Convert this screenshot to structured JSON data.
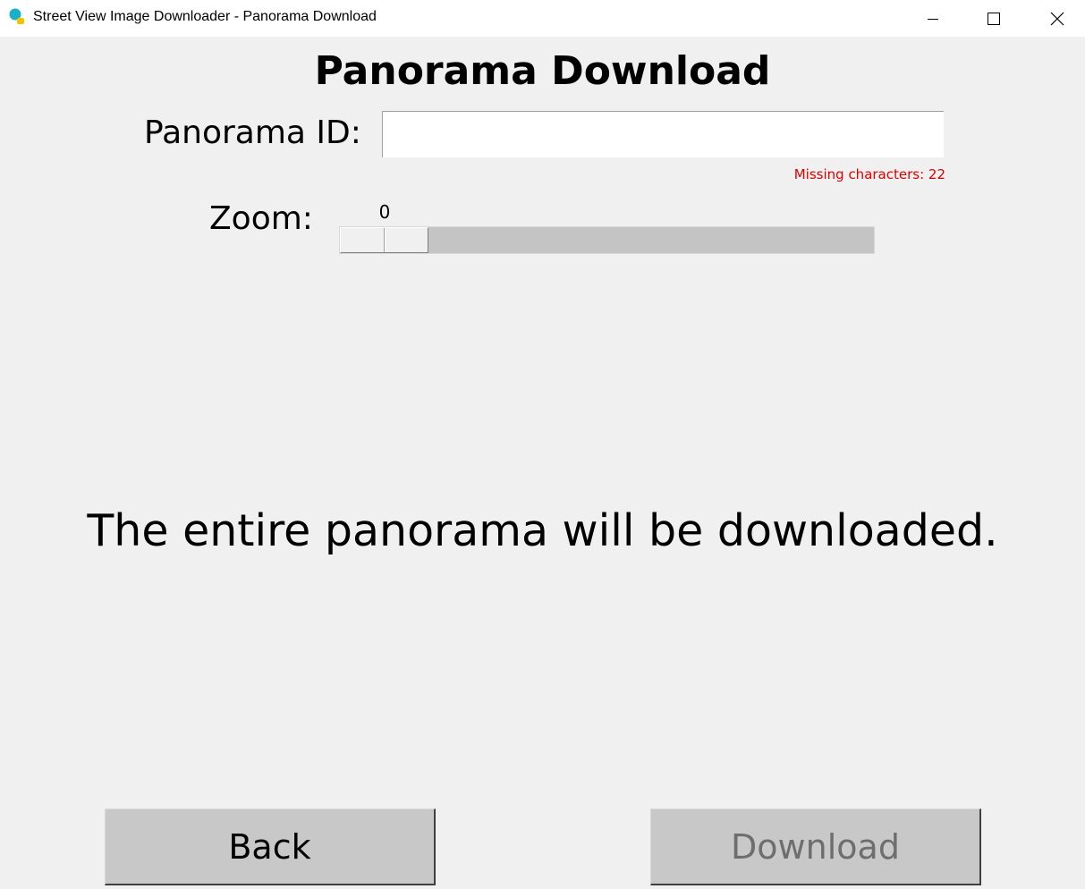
{
  "window": {
    "title": "Street View Image Downloader - Panorama Download"
  },
  "page": {
    "title": "Panorama Download",
    "id_label": "Panorama ID:",
    "id_value": "",
    "missing_chars": "Missing characters: 22",
    "zoom_label": "Zoom:",
    "zoom_value": "0",
    "info_text": "The entire panorama will be downloaded."
  },
  "buttons": {
    "back": "Back",
    "download": "Download"
  },
  "colors": {
    "background": "#f0f0f0",
    "error": "#e00000",
    "button": "#c8c8c8",
    "disabled_text": "#6e6e6e"
  },
  "icons": {
    "app": "street-view-app-icon",
    "minimize": "minimize-icon",
    "maximize": "maximize-icon",
    "close": "close-icon"
  },
  "zoom_slider": {
    "value": 0,
    "min": 0,
    "max": 5
  }
}
